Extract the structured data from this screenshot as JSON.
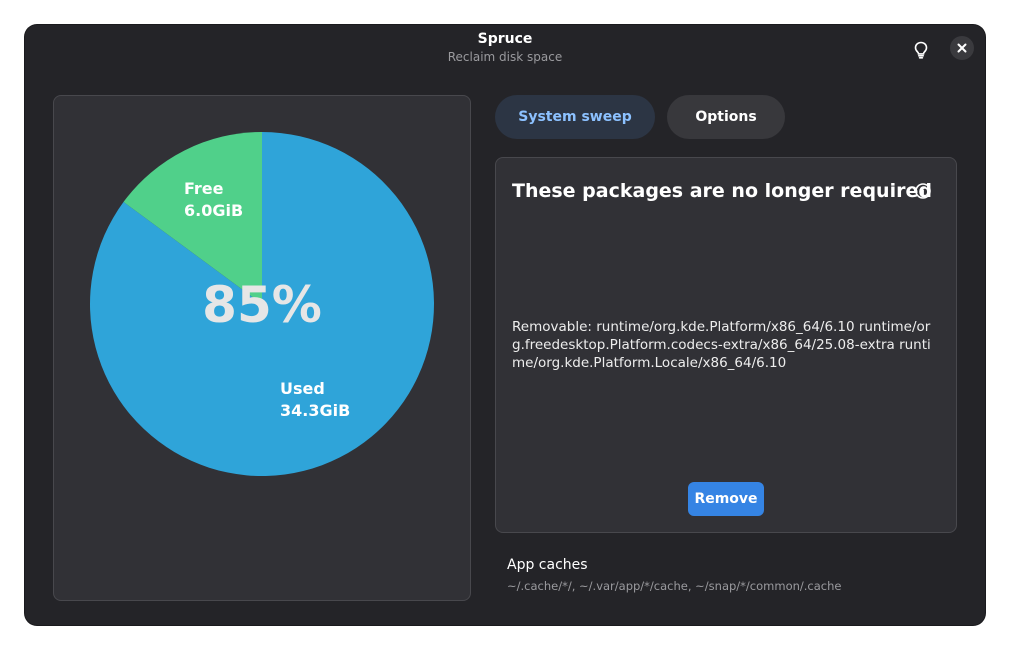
{
  "app": {
    "title": "Spruce",
    "subtitle": "Reclaim disk space"
  },
  "header": {
    "hint_icon": "lightbulb-icon",
    "close_icon": "close-icon"
  },
  "tabs": [
    {
      "label": "System sweep",
      "selected": true
    },
    {
      "label": "Options",
      "selected": false
    }
  ],
  "chart_data": {
    "type": "pie",
    "center_label": "85%",
    "slices": [
      {
        "name": "Used",
        "label": "Used",
        "value_label": "34.3GiB",
        "value": 34.3,
        "color": "#2fa4d9"
      },
      {
        "name": "Free",
        "label": "Free",
        "value_label": "6.0GiB",
        "value": 6.0,
        "color": "#50d08a"
      }
    ]
  },
  "packages": {
    "title": "These packages are no longer required",
    "info_icon": "info-icon",
    "removable_text": "Removable: runtime/org.kde.Platform/x86_64/6.10 runtime/org.freedesktop.Platform.codecs-extra/x86_64/25.08-extra runtime/org.kde.Platform.Locale/x86_64/6.10",
    "remove_label": "Remove"
  },
  "caches": {
    "title": "App caches",
    "paths": "~/.cache/*/, ~/.var/app/*/cache, ~/snap/*/common/.cache"
  },
  "colors": {
    "window_bg": "#242428",
    "card_bg": "#313136",
    "accent": "#3584e4",
    "tab_selected_text": "#8cc1ff"
  }
}
